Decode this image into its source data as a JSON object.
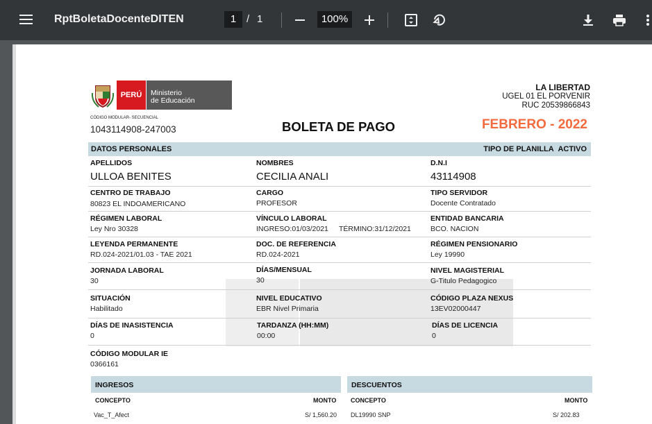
{
  "toolbar": {
    "title": "RptBoletaDocenteDITEN",
    "page_current": "1",
    "page_sep": "/",
    "page_total": "1",
    "zoom": "100%"
  },
  "header": {
    "logo_country": "PERÚ",
    "logo_ministry_line1": "Ministerio",
    "logo_ministry_line2": "de Educación",
    "codigo_modular_label": "CÓDIGO MODULAR- SECUENCIAL",
    "codigo_modular_value": "1043114908-247003",
    "title": "BOLETA DE PAGO",
    "region": "LA LIBERTAD",
    "ugel": "UGEL 01 EL PORVENIR",
    "ruc": "RUC 20539866843",
    "period": "FEBRERO - 2022"
  },
  "personal": {
    "section_title": "DATOS PERSONALES",
    "planilla_label": "TIPO DE PLANILLA",
    "planilla_value": "ACTIVO",
    "apellidos_label": "APELLIDOS",
    "apellidos_value": "ULLOA BENITES",
    "nombres_label": "NOMBRES",
    "nombres_value": "CECILIA ANALI",
    "dni_label": "D.N.I",
    "dni_value": "43114908",
    "centro_label": "CENTRO DE TRABAJO",
    "centro_value": "80823 EL INDOAMERICANO",
    "cargo_label": "CARGO",
    "cargo_value": "PROFESOR",
    "tipo_servidor_label": "TIPO SERVIDOR",
    "tipo_servidor_value": "Docente Contratado",
    "regimen_label": "RÉGIMEN LABORAL",
    "regimen_value": "Ley Nro 30328",
    "vinculo_label": "VÍNCULO LABORAL",
    "vinculo_ingreso": "INGRESO:01/03/2021",
    "vinculo_termino": "TÉRMINO:31/12/2021",
    "entidad_label": "ENTIDAD BANCARIA",
    "entidad_value": "BCO. NACION",
    "leyenda_label": "LEYENDA PERMANENTE",
    "leyenda_value": "RD.024-2021/01.03 - TAE 2021",
    "docref_label": "DOC. DE REFERENCIA",
    "docref_value": "RD.024-2021",
    "pension_label": "RÉGIMEN PENSIONARIO",
    "pension_value": "Ley 19990",
    "jornada_label": "JORNADA LABORAL",
    "jornada_value": "30",
    "dias_label": "DÍAS/MENSUAL",
    "dias_value": "30",
    "nivel_mag_label": "NIVEL MAGISTERIAL",
    "nivel_mag_value": "G-Titulo Pedagogico",
    "situacion_label": "SITUACIÓN",
    "situacion_value": "Habilitado",
    "nivel_edu_label": "NIVEL EDUCATIVO",
    "nivel_edu_value": "EBR Nivel Primaria",
    "plaza_label": "CÓDIGO PLAZA NEXUS",
    "plaza_value": "13EV02000447",
    "inasistencia_label": "DÍAS DE INASISTENCIA",
    "inasistencia_value": "0",
    "tardanza_label": "TARDANZA  (HH:MM)",
    "tardanza_value": "00:00",
    "licencia_label": "DÍAS DE LICENCIA",
    "licencia_value": "0",
    "codigo_ie_label": "CÓDIGO MODULAR IE",
    "codigo_ie_value": "0366161"
  },
  "ingresos": {
    "title": "INGRESOS",
    "col_concepto": "CONCEPTO",
    "col_monto": "MONTO",
    "rows": [
      {
        "concepto": "Vac_T_Afect",
        "monto": "S/ 1,560.20"
      }
    ]
  },
  "descuentos": {
    "title": "DESCUENTOS",
    "col_concepto": "CONCEPTO",
    "col_monto": "MONTO",
    "rows": [
      {
        "concepto": "DL19990 SNP",
        "monto": "S/ 202.83"
      }
    ]
  },
  "colors": {
    "toolbar_bg": "#323639",
    "viewer_bg": "#525659",
    "section_bg": "#c7d9e1",
    "period_orange": "#f26a3d",
    "peru_red": "#d71920",
    "ministry_gray": "#585858"
  },
  "icons": [
    "menu-icon",
    "zoom-out-icon",
    "zoom-in-icon",
    "fit-page-icon",
    "rotate-icon",
    "download-icon",
    "print-icon",
    "more-vert-icon"
  ]
}
